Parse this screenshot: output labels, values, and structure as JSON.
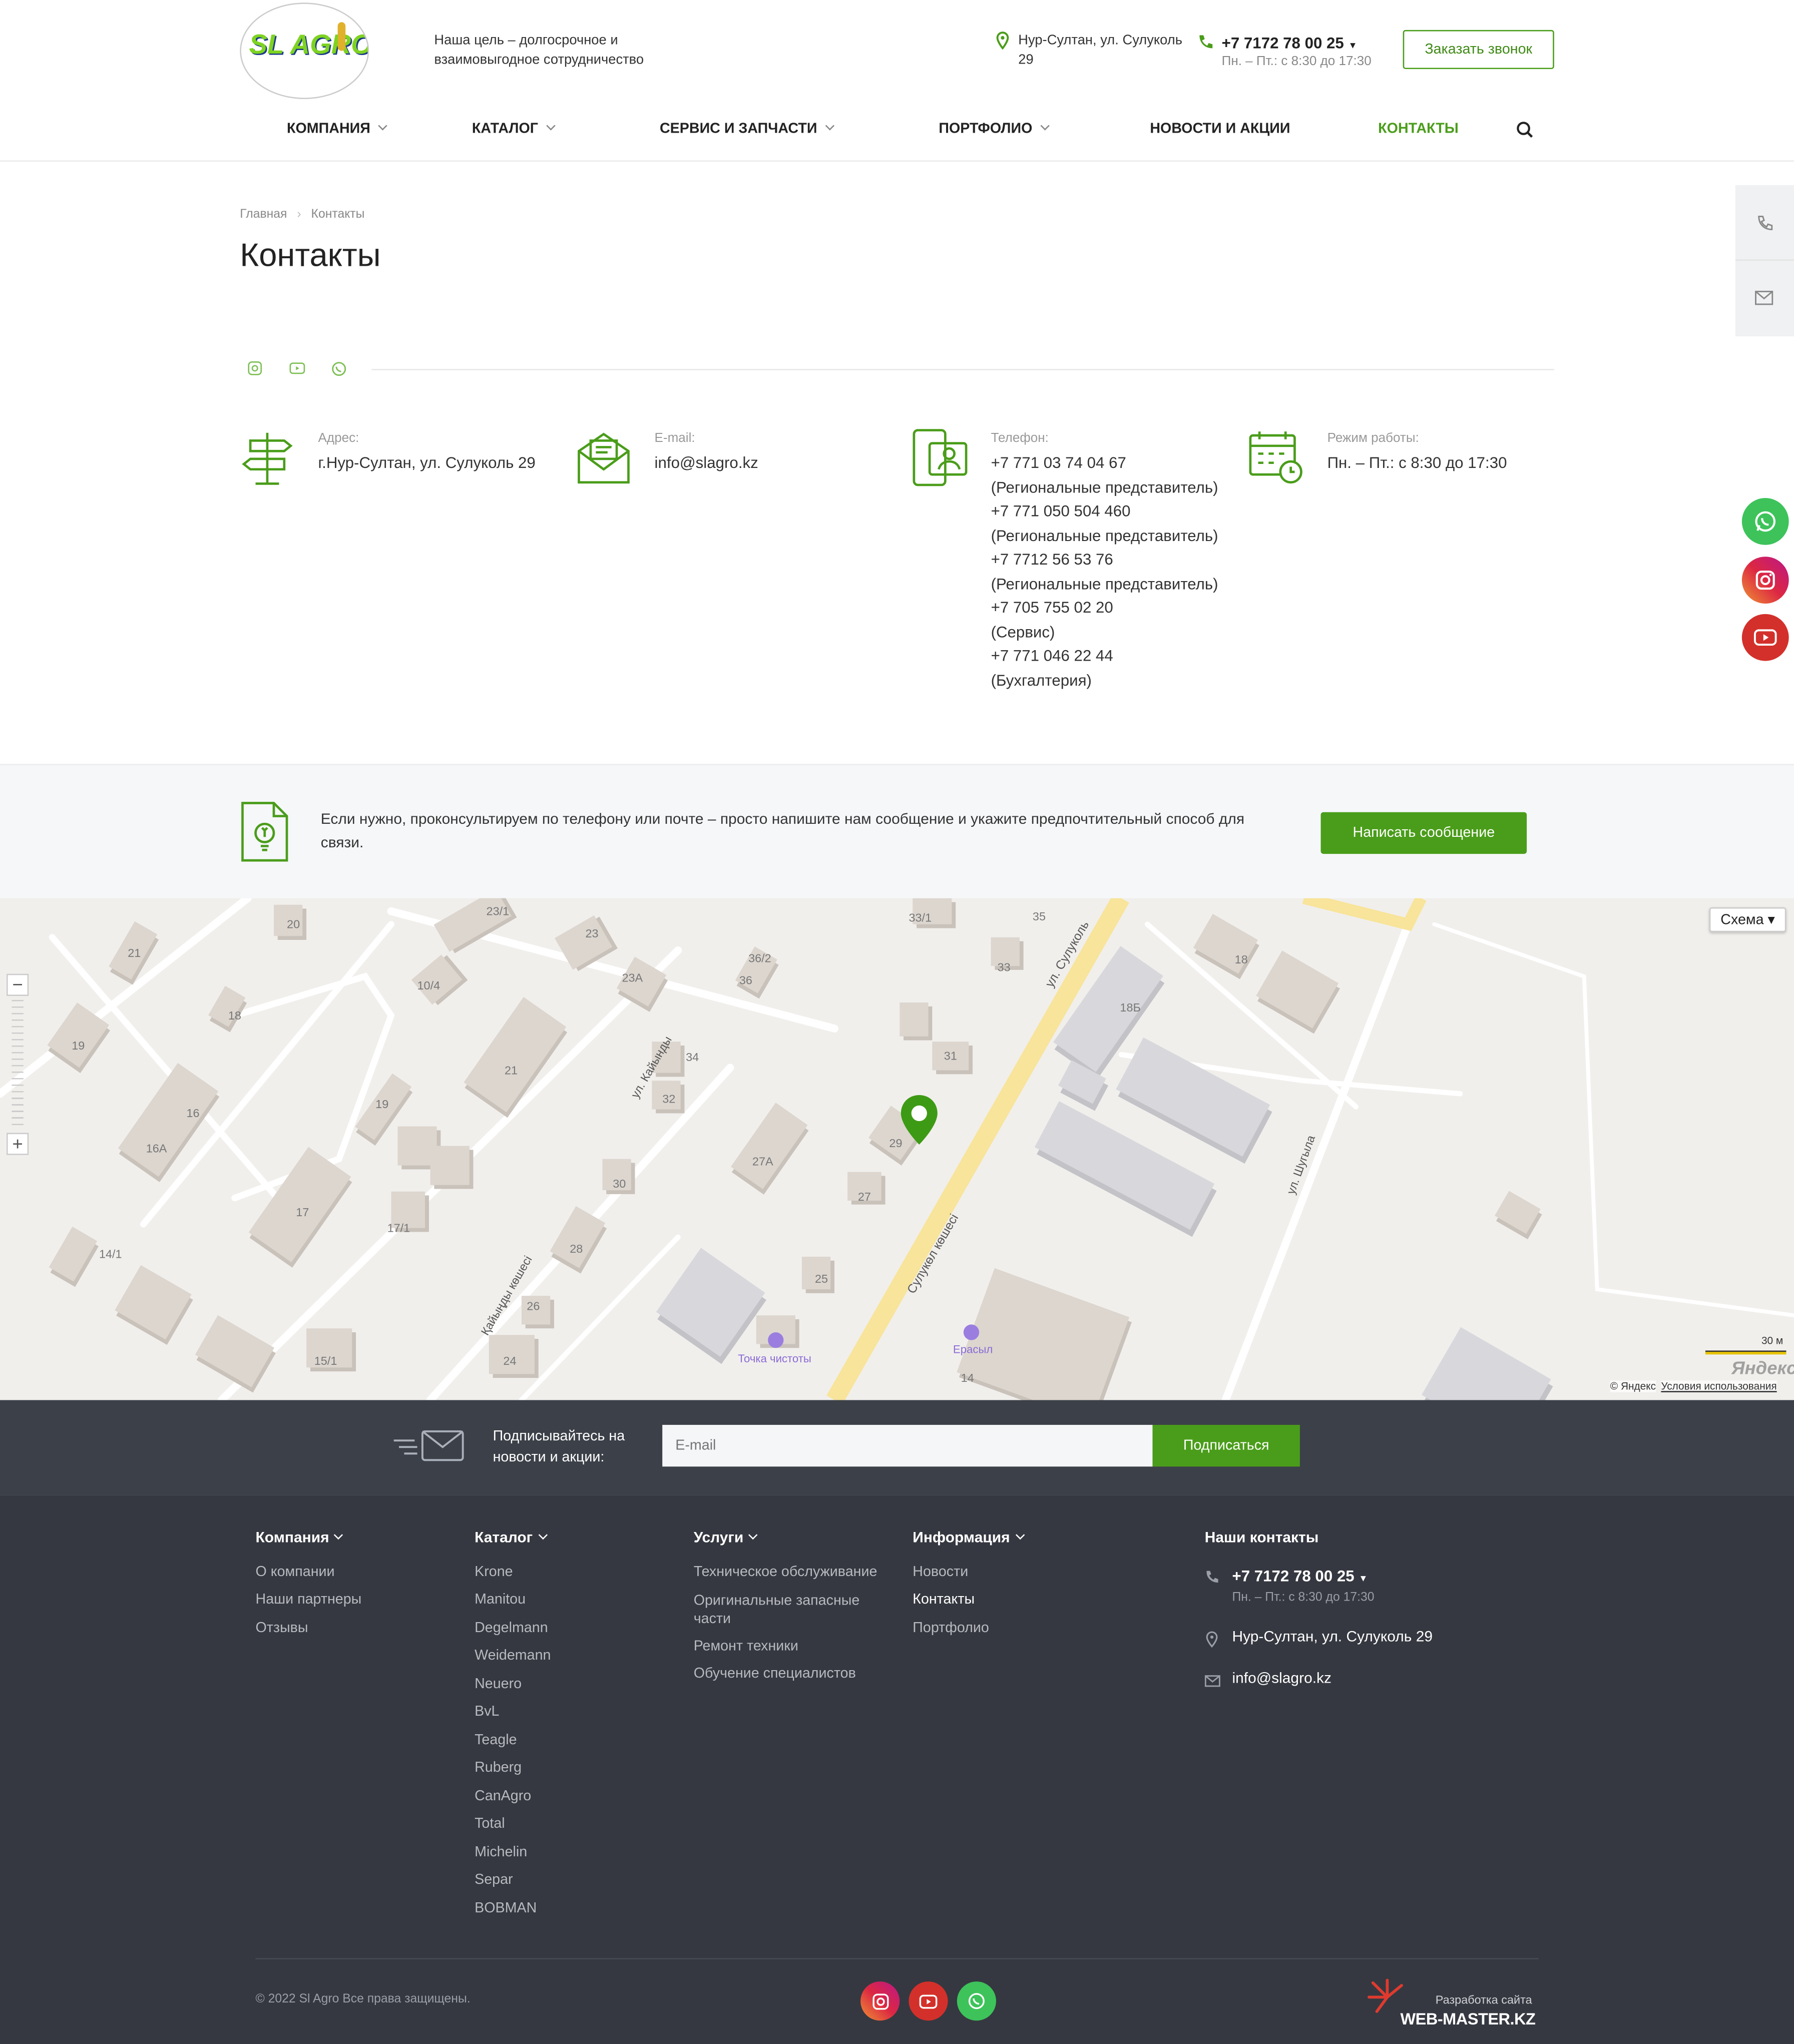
{
  "header": {
    "logo_text": "SL AGRO",
    "tagline": "Наша цель – долгосрочное и взаимовыгодное сотрудничество",
    "address": "Нур-Султан, ул. Сулуколь 29",
    "phone": "+7 7172 78 00 25",
    "hours": "Пн. – Пт.: с 8:30 до 17:30",
    "callback_button": "Заказать звонок",
    "nav": [
      "КОМПАНИЯ",
      "КАТАЛОГ",
      "СЕРВИС И ЗАПЧАСТИ",
      "ПОРТФОЛИО",
      "НОВОСТИ И АКЦИИ",
      "КОНТАКТЫ"
    ]
  },
  "breadcrumb": [
    "Главная",
    "Контакты"
  ],
  "page_title": "Контакты",
  "contacts": {
    "address_label": "Адрес:",
    "address_value": "г.Нур-Султан, ул. Сулуколь 29",
    "email_label": "E-mail:",
    "email_value": "info@slagro.kz",
    "phone_label": "Телефон:",
    "phones": [
      {
        "number": "+7 771 03 74 04 67",
        "note": "(Региональные представитель)"
      },
      {
        "number": "+7 771 050 504 460",
        "note": "(Региональные представитель)"
      },
      {
        "number": "+7 7712 56 53 76",
        "note": "(Региональные представитель)"
      },
      {
        "number": "+7 705 755 02 20",
        "note": "(Сервис)"
      },
      {
        "number": "+7 771 046 22 44",
        "note": "(Бухгалтерия)"
      }
    ],
    "hours_label": "Режим работы:",
    "hours_value": "Пн. – Пт.: с 8:30 до 17:30"
  },
  "cta": {
    "text": "Если нужно, проконсультируем по телефону или почте – просто напишите нам сообщение и укажите предпочтительный способ для связи.",
    "button": "Написать сообщение"
  },
  "map": {
    "type_selector": "Схема ▾",
    "streets": [
      "ул. Сулуколь",
      "Сулукөл көшесі",
      "ул. Кайынды",
      "Қайыңды көшесі",
      "ул. Шугыла"
    ],
    "house_numbers": [
      "20",
      "21",
      "23/1",
      "23",
      "33/1",
      "35",
      "18",
      "36/2",
      "36",
      "23A",
      "10/4",
      "18",
      "19",
      "33",
      "18Б",
      "34",
      "31",
      "21",
      "32",
      "19",
      "16",
      "16A",
      "29",
      "27A",
      "30",
      "27",
      "17",
      "17/1",
      "28",
      "14/1",
      "25",
      "26",
      "15/1",
      "24",
      "14"
    ],
    "pois": [
      "Точка чистоты",
      "Ерасыл"
    ],
    "scale": "30 м",
    "brand": "Яндекс",
    "copyright": "© Яндекс",
    "terms": "Условия использования"
  },
  "subscribe": {
    "label": "Подписывайтесь на новости и акции:",
    "placeholder": "E-mail",
    "button": "Подписаться"
  },
  "footer": {
    "columns": [
      {
        "title": "Компания",
        "items": [
          "О компании",
          "Наши партнеры",
          "Отзывы"
        ]
      },
      {
        "title": "Каталог",
        "items": [
          "Krone",
          "Manitou",
          "Degelmann",
          "Weidemann",
          "Neuero",
          "BvL",
          "Teagle",
          "Ruberg",
          "CanAgro",
          "Total",
          "Michelin",
          "Separ",
          "BOBMAN"
        ]
      },
      {
        "title": "Услуги",
        "items": [
          "Техническое обслуживание",
          "Оригинальные запасные части",
          "Ремонт техники",
          "Обучение специалистов"
        ]
      },
      {
        "title": "Информация",
        "items": [
          "Новости",
          "Контакты",
          "Портфолио"
        ]
      }
    ],
    "contacts_title": "Наши контакты",
    "phone": "+7 7172 78 00 25",
    "hours": "Пн. – Пт.: с 8:30 до 17:30",
    "address": "Нур-Султан, ул. Сулуколь 29",
    "email": "info@slagro.kz",
    "copyright": "© 2022 Sl Agro Все права защищены.",
    "developer_label": "Разработка сайта",
    "developer_name": "WEB-MASTER.KZ"
  },
  "colors": {
    "accent": "#4a9d1a",
    "footer_bg": "#353840",
    "subscribe_bg": "#3c4048"
  }
}
